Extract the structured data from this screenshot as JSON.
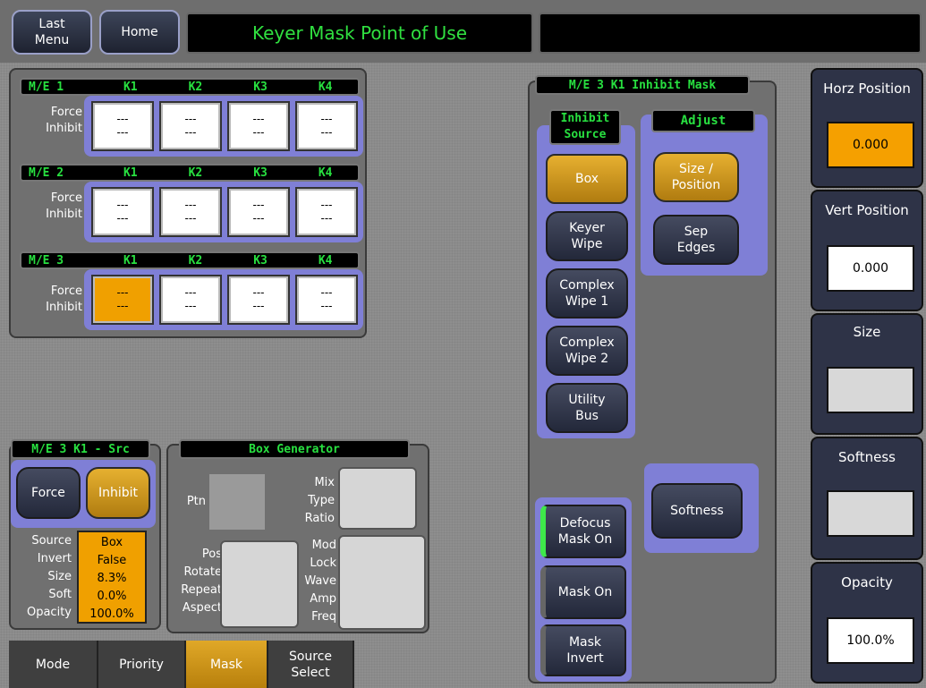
{
  "header": {
    "last_menu": "Last\nMenu",
    "home": "Home",
    "title": "Keyer Mask Point of Use"
  },
  "force_inhibit": {
    "label": "Force\nInhibit",
    "key_headers": [
      "K1",
      "K2",
      "K3",
      "K4"
    ],
    "rows": [
      {
        "me": "M/E 1",
        "cells": [
          "---\n---",
          "---\n---",
          "---\n---",
          "---\n---"
        ],
        "active": []
      },
      {
        "me": "M/E 2",
        "cells": [
          "---\n---",
          "---\n---",
          "---\n---",
          "---\n---"
        ],
        "active": []
      },
      {
        "me": "M/E 3",
        "cells": [
          "---\n---",
          "---\n---",
          "---\n---",
          "---\n---"
        ],
        "active": [
          0
        ]
      }
    ]
  },
  "src_panel": {
    "title": "M/E 3 K1 - Src",
    "force": "Force",
    "inhibit": "Inhibit",
    "labels": [
      "Source",
      "Invert",
      "Size",
      "Soft",
      "Opacity"
    ],
    "values": [
      "Box",
      "False",
      "8.3%",
      "0.0%",
      "100.0%"
    ]
  },
  "box_gen": {
    "title": "Box Generator",
    "ptn": "Ptn",
    "mix_labels": [
      "Mix",
      "Type",
      "Ratio"
    ],
    "pos_labels": [
      "Pos",
      "Rotate",
      "Repeat",
      "Aspect"
    ],
    "mod_labels": [
      "Mod",
      "Lock",
      "Wave",
      "Amp",
      "Freq"
    ]
  },
  "inhibit_mask": {
    "title": "M/E 3 K1 Inhibit Mask",
    "inhibit_source_title": "Inhibit\nSource",
    "sources": [
      "Box",
      "Keyer\nWipe",
      "Complex\nWipe 1",
      "Complex\nWipe 2",
      "Utility\nBus"
    ],
    "adjust_title": "Adjust",
    "adjust": [
      "Size /\nPosition",
      "Sep\nEdges"
    ],
    "softness": "Softness",
    "defocus": "Defocus\nMask On",
    "mask_on": "Mask On",
    "mask_invert": "Mask\nInvert"
  },
  "right_panel": {
    "horz": {
      "label": "Horz Position",
      "value": "0.000"
    },
    "vert": {
      "label": "Vert Position",
      "value": "0.000"
    },
    "size": {
      "label": "Size",
      "value": ""
    },
    "softness": {
      "label": "Softness",
      "value": ""
    },
    "opacity": {
      "label": "Opacity",
      "value": "100.0%"
    }
  },
  "tabs": [
    "Mode",
    "Priority",
    "Mask",
    "Source\nSelect"
  ],
  "colors": {
    "accent_gold": "#e0a828",
    "header_green": "#28e040",
    "panel_purple": "#7f7fd6"
  }
}
